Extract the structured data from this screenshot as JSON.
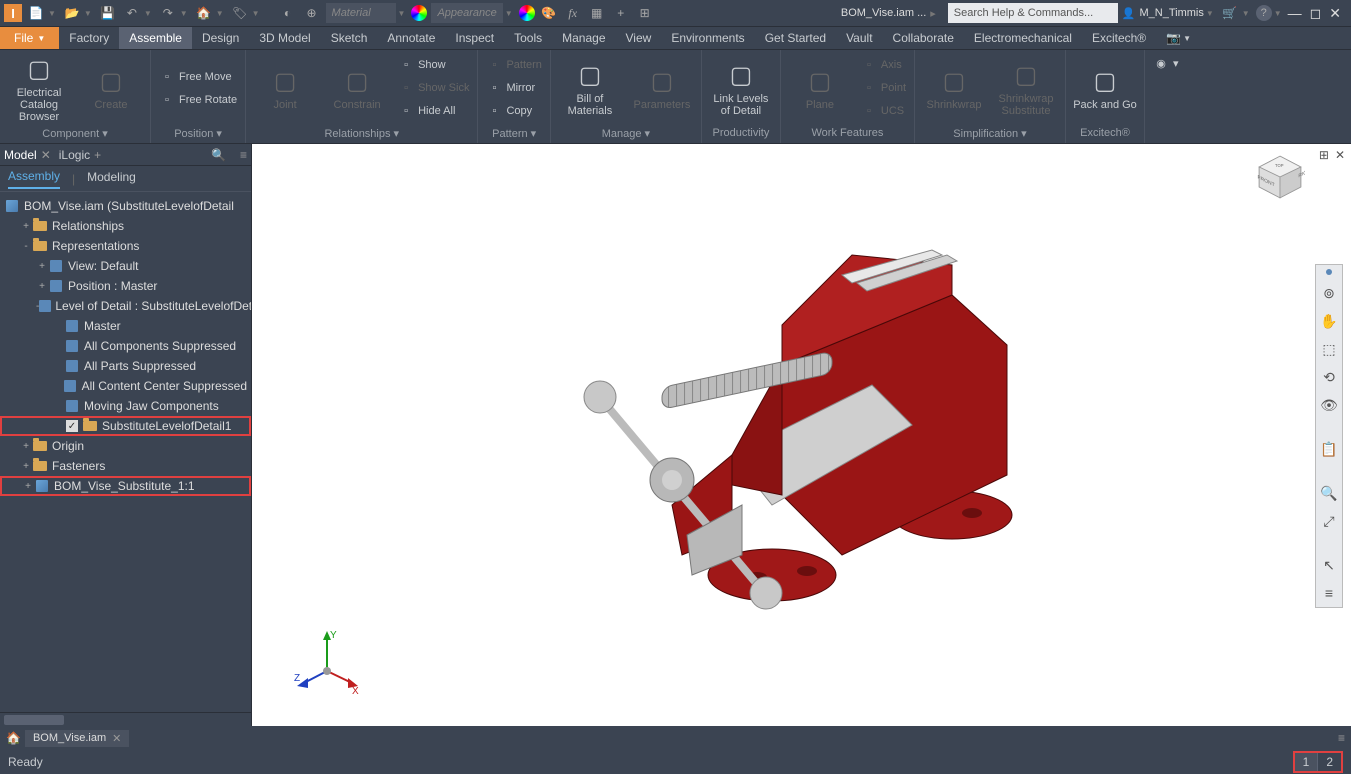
{
  "app": {
    "icon_letter": "I"
  },
  "titlebar": {
    "material_label": "Material",
    "appearance_label": "Appearance",
    "doc_name": "BOM_Vise.iam ...",
    "search_placeholder": "Search Help & Commands...",
    "user_name": "M_N_Timmis"
  },
  "menu": {
    "file": "File",
    "items": [
      "Factory",
      "Assemble",
      "Design",
      "3D Model",
      "Sketch",
      "Annotate",
      "Inspect",
      "Tools",
      "Manage",
      "View",
      "Environments",
      "Get Started",
      "Vault",
      "Collaborate",
      "Electromechanical",
      "Excitech®"
    ],
    "active_index": 1
  },
  "ribbon": {
    "groups": [
      {
        "label": "Component ▾",
        "items": [
          {
            "big": true,
            "label": "Electrical\nCatalog Browser"
          },
          {
            "big": true,
            "label": "Create",
            "disabled": true
          }
        ]
      },
      {
        "label": "Position ▾",
        "items": [
          {
            "small": [
              "Free Move",
              "Free Rotate"
            ]
          }
        ]
      },
      {
        "label": "Relationships ▾",
        "items": [
          {
            "big": true,
            "label": "Joint",
            "disabled": true
          },
          {
            "big": true,
            "label": "Constrain",
            "disabled": true
          },
          {
            "small": [
              "Show",
              "Show Sick",
              "Hide All"
            ],
            "disabled": [
              false,
              true,
              false
            ]
          }
        ]
      },
      {
        "label": "Pattern ▾",
        "items": [
          {
            "small": [
              "Pattern",
              "Mirror",
              "Copy"
            ],
            "disabled": [
              true,
              false,
              false
            ]
          }
        ]
      },
      {
        "label": "Manage ▾",
        "items": [
          {
            "big": true,
            "label": "Bill of\nMaterials"
          },
          {
            "big": true,
            "label": "Parameters",
            "disabled": true
          }
        ]
      },
      {
        "label": "Productivity",
        "items": [
          {
            "big": true,
            "label": "Link Levels\nof Detail"
          }
        ]
      },
      {
        "label": "Work Features",
        "items": [
          {
            "big": true,
            "label": "Plane",
            "disabled": true
          },
          {
            "small": [
              "Axis",
              "Point",
              "UCS"
            ],
            "disabled": [
              true,
              true,
              true
            ]
          }
        ]
      },
      {
        "label": "Simplification ▾",
        "items": [
          {
            "big": true,
            "label": "Shrinkwrap",
            "disabled": true
          },
          {
            "big": true,
            "label": "Shrinkwrap\nSubstitute",
            "disabled": true
          }
        ]
      },
      {
        "label": "Excitech®",
        "items": [
          {
            "big": true,
            "label": "Pack and Go"
          }
        ]
      }
    ]
  },
  "browser": {
    "tabs": [
      {
        "label": "Model",
        "active": true,
        "closable": true
      },
      {
        "label": "iLogic",
        "active": false,
        "add": true
      }
    ],
    "subtabs": [
      {
        "label": "Assembly",
        "active": true
      },
      {
        "label": "Modeling",
        "active": false
      }
    ],
    "root": "BOM_Vise.iam (SubstituteLevelofDetail",
    "tree": [
      {
        "label": "Relationships",
        "depth": 1,
        "exp": "+",
        "icon": "folder"
      },
      {
        "label": "Representations",
        "depth": 1,
        "exp": "-",
        "icon": "folder"
      },
      {
        "label": "View: Default",
        "depth": 2,
        "exp": "+",
        "icon": "lod"
      },
      {
        "label": "Position : Master",
        "depth": 2,
        "exp": "+",
        "icon": "lod"
      },
      {
        "label": "Level of Detail : SubstituteLevelofDetail",
        "depth": 2,
        "exp": "-",
        "icon": "lod"
      },
      {
        "label": "Master",
        "depth": 3,
        "icon": "lod"
      },
      {
        "label": "All Components Suppressed",
        "depth": 3,
        "icon": "lod"
      },
      {
        "label": "All Parts Suppressed",
        "depth": 3,
        "icon": "lod"
      },
      {
        "label": "All Content Center Suppressed",
        "depth": 3,
        "icon": "lod"
      },
      {
        "label": "Moving Jaw Components",
        "depth": 3,
        "icon": "lod"
      },
      {
        "label": "SubstituteLevelofDetail1",
        "depth": 3,
        "icon": "folder",
        "check": true,
        "hl": true
      },
      {
        "label": "Origin",
        "depth": 1,
        "exp": "+",
        "icon": "folder"
      },
      {
        "label": "Fasteners",
        "depth": 1,
        "exp": "+",
        "icon": "folder"
      },
      {
        "label": "BOM_Vise_Substitute_1:1",
        "depth": 1,
        "exp": "+",
        "icon": "cube",
        "hl": true
      }
    ]
  },
  "canvas": {
    "doc_tab": "BOM_Vise.iam",
    "viewcube": {
      "front": "FRONT",
      "right": "RIGHT",
      "top": "TOP"
    },
    "axes": {
      "x": "X",
      "y": "Y",
      "z": "Z"
    }
  },
  "status": {
    "ready": "Ready",
    "pages": [
      "1",
      "2"
    ]
  }
}
